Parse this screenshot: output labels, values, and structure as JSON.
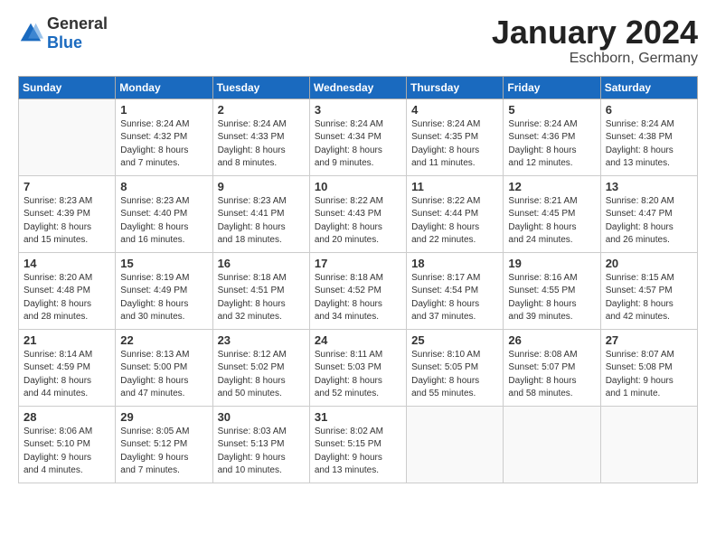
{
  "logo": {
    "general": "General",
    "blue": "Blue"
  },
  "header": {
    "month": "January 2024",
    "location": "Eschborn, Germany"
  },
  "weekdays": [
    "Sunday",
    "Monday",
    "Tuesday",
    "Wednesday",
    "Thursday",
    "Friday",
    "Saturday"
  ],
  "weeks": [
    [
      {
        "day": "",
        "lines": []
      },
      {
        "day": "1",
        "lines": [
          "Sunrise: 8:24 AM",
          "Sunset: 4:32 PM",
          "Daylight: 8 hours",
          "and 7 minutes."
        ]
      },
      {
        "day": "2",
        "lines": [
          "Sunrise: 8:24 AM",
          "Sunset: 4:33 PM",
          "Daylight: 8 hours",
          "and 8 minutes."
        ]
      },
      {
        "day": "3",
        "lines": [
          "Sunrise: 8:24 AM",
          "Sunset: 4:34 PM",
          "Daylight: 8 hours",
          "and 9 minutes."
        ]
      },
      {
        "day": "4",
        "lines": [
          "Sunrise: 8:24 AM",
          "Sunset: 4:35 PM",
          "Daylight: 8 hours",
          "and 11 minutes."
        ]
      },
      {
        "day": "5",
        "lines": [
          "Sunrise: 8:24 AM",
          "Sunset: 4:36 PM",
          "Daylight: 8 hours",
          "and 12 minutes."
        ]
      },
      {
        "day": "6",
        "lines": [
          "Sunrise: 8:24 AM",
          "Sunset: 4:38 PM",
          "Daylight: 8 hours",
          "and 13 minutes."
        ]
      }
    ],
    [
      {
        "day": "7",
        "lines": [
          "Sunrise: 8:23 AM",
          "Sunset: 4:39 PM",
          "Daylight: 8 hours",
          "and 15 minutes."
        ]
      },
      {
        "day": "8",
        "lines": [
          "Sunrise: 8:23 AM",
          "Sunset: 4:40 PM",
          "Daylight: 8 hours",
          "and 16 minutes."
        ]
      },
      {
        "day": "9",
        "lines": [
          "Sunrise: 8:23 AM",
          "Sunset: 4:41 PM",
          "Daylight: 8 hours",
          "and 18 minutes."
        ]
      },
      {
        "day": "10",
        "lines": [
          "Sunrise: 8:22 AM",
          "Sunset: 4:43 PM",
          "Daylight: 8 hours",
          "and 20 minutes."
        ]
      },
      {
        "day": "11",
        "lines": [
          "Sunrise: 8:22 AM",
          "Sunset: 4:44 PM",
          "Daylight: 8 hours",
          "and 22 minutes."
        ]
      },
      {
        "day": "12",
        "lines": [
          "Sunrise: 8:21 AM",
          "Sunset: 4:45 PM",
          "Daylight: 8 hours",
          "and 24 minutes."
        ]
      },
      {
        "day": "13",
        "lines": [
          "Sunrise: 8:20 AM",
          "Sunset: 4:47 PM",
          "Daylight: 8 hours",
          "and 26 minutes."
        ]
      }
    ],
    [
      {
        "day": "14",
        "lines": [
          "Sunrise: 8:20 AM",
          "Sunset: 4:48 PM",
          "Daylight: 8 hours",
          "and 28 minutes."
        ]
      },
      {
        "day": "15",
        "lines": [
          "Sunrise: 8:19 AM",
          "Sunset: 4:49 PM",
          "Daylight: 8 hours",
          "and 30 minutes."
        ]
      },
      {
        "day": "16",
        "lines": [
          "Sunrise: 8:18 AM",
          "Sunset: 4:51 PM",
          "Daylight: 8 hours",
          "and 32 minutes."
        ]
      },
      {
        "day": "17",
        "lines": [
          "Sunrise: 8:18 AM",
          "Sunset: 4:52 PM",
          "Daylight: 8 hours",
          "and 34 minutes."
        ]
      },
      {
        "day": "18",
        "lines": [
          "Sunrise: 8:17 AM",
          "Sunset: 4:54 PM",
          "Daylight: 8 hours",
          "and 37 minutes."
        ]
      },
      {
        "day": "19",
        "lines": [
          "Sunrise: 8:16 AM",
          "Sunset: 4:55 PM",
          "Daylight: 8 hours",
          "and 39 minutes."
        ]
      },
      {
        "day": "20",
        "lines": [
          "Sunrise: 8:15 AM",
          "Sunset: 4:57 PM",
          "Daylight: 8 hours",
          "and 42 minutes."
        ]
      }
    ],
    [
      {
        "day": "21",
        "lines": [
          "Sunrise: 8:14 AM",
          "Sunset: 4:59 PM",
          "Daylight: 8 hours",
          "and 44 minutes."
        ]
      },
      {
        "day": "22",
        "lines": [
          "Sunrise: 8:13 AM",
          "Sunset: 5:00 PM",
          "Daylight: 8 hours",
          "and 47 minutes."
        ]
      },
      {
        "day": "23",
        "lines": [
          "Sunrise: 8:12 AM",
          "Sunset: 5:02 PM",
          "Daylight: 8 hours",
          "and 50 minutes."
        ]
      },
      {
        "day": "24",
        "lines": [
          "Sunrise: 8:11 AM",
          "Sunset: 5:03 PM",
          "Daylight: 8 hours",
          "and 52 minutes."
        ]
      },
      {
        "day": "25",
        "lines": [
          "Sunrise: 8:10 AM",
          "Sunset: 5:05 PM",
          "Daylight: 8 hours",
          "and 55 minutes."
        ]
      },
      {
        "day": "26",
        "lines": [
          "Sunrise: 8:08 AM",
          "Sunset: 5:07 PM",
          "Daylight: 8 hours",
          "and 58 minutes."
        ]
      },
      {
        "day": "27",
        "lines": [
          "Sunrise: 8:07 AM",
          "Sunset: 5:08 PM",
          "Daylight: 9 hours",
          "and 1 minute."
        ]
      }
    ],
    [
      {
        "day": "28",
        "lines": [
          "Sunrise: 8:06 AM",
          "Sunset: 5:10 PM",
          "Daylight: 9 hours",
          "and 4 minutes."
        ]
      },
      {
        "day": "29",
        "lines": [
          "Sunrise: 8:05 AM",
          "Sunset: 5:12 PM",
          "Daylight: 9 hours",
          "and 7 minutes."
        ]
      },
      {
        "day": "30",
        "lines": [
          "Sunrise: 8:03 AM",
          "Sunset: 5:13 PM",
          "Daylight: 9 hours",
          "and 10 minutes."
        ]
      },
      {
        "day": "31",
        "lines": [
          "Sunrise: 8:02 AM",
          "Sunset: 5:15 PM",
          "Daylight: 9 hours",
          "and 13 minutes."
        ]
      },
      {
        "day": "",
        "lines": []
      },
      {
        "day": "",
        "lines": []
      },
      {
        "day": "",
        "lines": []
      }
    ]
  ]
}
